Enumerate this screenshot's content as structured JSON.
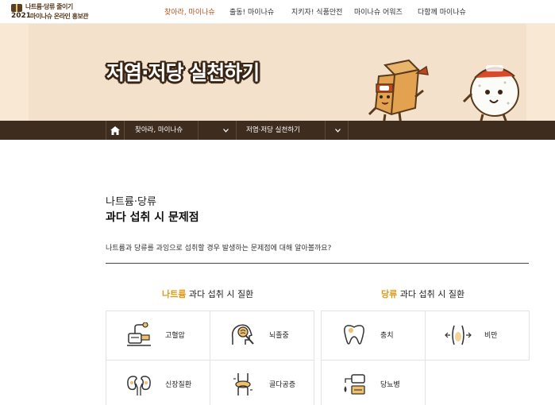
{
  "header": {
    "logo_line1": "나트륨·당류 줄이기",
    "logo_year": "2021",
    "logo_line2": "마이나슈 온라인 홍보관",
    "nav": [
      {
        "label": "찾아라, 마이나슈",
        "active": true
      },
      {
        "label": "출동! 마이나슈",
        "active": false
      },
      {
        "label": "지키자! 식품안전",
        "active": false
      },
      {
        "label": "마이나슈 어워즈",
        "active": false
      },
      {
        "label": "다함께 마이나슈",
        "active": false
      }
    ]
  },
  "banner": {
    "title": "저염·저당 실천하기"
  },
  "subnav": {
    "level1": "찾아라, 마이나슈",
    "level2": "저염·저당 실천하기"
  },
  "content": {
    "subtitle": "나트륨·당류",
    "title": "과다 섭취 시 문제점",
    "intro": "나트륨과 당류를 과잉으로 섭취할 경우 발생하는 문제점에 대해 알아볼까요?"
  },
  "sections": [
    {
      "highlight": "나트륨",
      "heading": " 과다 섭취 시 질환",
      "items": [
        {
          "label": "고혈압",
          "icon": "blood-pressure-icon"
        },
        {
          "label": "뇌졸중",
          "icon": "brain-icon"
        },
        {
          "label": "신장질환",
          "icon": "kidney-icon"
        },
        {
          "label": "골다공증",
          "icon": "bone-icon"
        }
      ]
    },
    {
      "highlight": "당류",
      "heading": " 과다 섭취 시 질환",
      "items": [
        {
          "label": "충치",
          "icon": "tooth-icon"
        },
        {
          "label": "비만",
          "icon": "obesity-icon"
        },
        {
          "label": "당뇨병",
          "icon": "diabetes-icon"
        }
      ]
    }
  ],
  "colors": {
    "accent": "#e09a17",
    "nav_active": "#c0501e",
    "subnav_bg": "#3e2d1f",
    "banner_bg": "#f3e1cb"
  }
}
